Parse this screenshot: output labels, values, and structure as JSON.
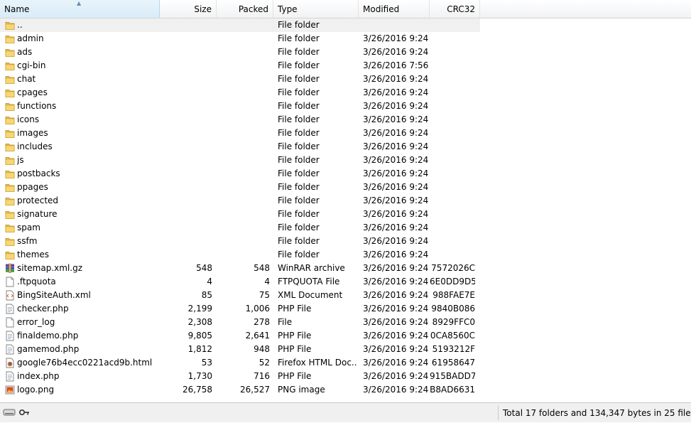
{
  "columns": {
    "name": "Name",
    "size": "Size",
    "packed": "Packed",
    "type": "Type",
    "modified": "Modified",
    "crc": "CRC32"
  },
  "files": [
    {
      "name": "..",
      "size": "",
      "packed": "",
      "type": "File folder",
      "modified": "",
      "crc": "",
      "icon": "folder-icon"
    },
    {
      "name": "admin",
      "size": "",
      "packed": "",
      "type": "File folder",
      "modified": "3/26/2016 9:24",
      "crc": "",
      "icon": "folder-icon"
    },
    {
      "name": "ads",
      "size": "",
      "packed": "",
      "type": "File folder",
      "modified": "3/26/2016 9:24",
      "crc": "",
      "icon": "folder-icon"
    },
    {
      "name": "cgi-bin",
      "size": "",
      "packed": "",
      "type": "File folder",
      "modified": "3/26/2016 7:56",
      "crc": "",
      "icon": "folder-icon"
    },
    {
      "name": "chat",
      "size": "",
      "packed": "",
      "type": "File folder",
      "modified": "3/26/2016 9:24",
      "crc": "",
      "icon": "folder-icon"
    },
    {
      "name": "cpages",
      "size": "",
      "packed": "",
      "type": "File folder",
      "modified": "3/26/2016 9:24",
      "crc": "",
      "icon": "folder-icon"
    },
    {
      "name": "functions",
      "size": "",
      "packed": "",
      "type": "File folder",
      "modified": "3/26/2016 9:24",
      "crc": "",
      "icon": "folder-icon"
    },
    {
      "name": "icons",
      "size": "",
      "packed": "",
      "type": "File folder",
      "modified": "3/26/2016 9:24",
      "crc": "",
      "icon": "folder-icon"
    },
    {
      "name": "images",
      "size": "",
      "packed": "",
      "type": "File folder",
      "modified": "3/26/2016 9:24",
      "crc": "",
      "icon": "folder-icon"
    },
    {
      "name": "includes",
      "size": "",
      "packed": "",
      "type": "File folder",
      "modified": "3/26/2016 9:24",
      "crc": "",
      "icon": "folder-icon"
    },
    {
      "name": "js",
      "size": "",
      "packed": "",
      "type": "File folder",
      "modified": "3/26/2016 9:24",
      "crc": "",
      "icon": "folder-icon"
    },
    {
      "name": "postbacks",
      "size": "",
      "packed": "",
      "type": "File folder",
      "modified": "3/26/2016 9:24",
      "crc": "",
      "icon": "folder-icon"
    },
    {
      "name": "ppages",
      "size": "",
      "packed": "",
      "type": "File folder",
      "modified": "3/26/2016 9:24",
      "crc": "",
      "icon": "folder-icon"
    },
    {
      "name": "protected",
      "size": "",
      "packed": "",
      "type": "File folder",
      "modified": "3/26/2016 9:24",
      "crc": "",
      "icon": "folder-icon"
    },
    {
      "name": "signature",
      "size": "",
      "packed": "",
      "type": "File folder",
      "modified": "3/26/2016 9:24",
      "crc": "",
      "icon": "folder-icon"
    },
    {
      "name": "spam",
      "size": "",
      "packed": "",
      "type": "File folder",
      "modified": "3/26/2016 9:24",
      "crc": "",
      "icon": "folder-icon"
    },
    {
      "name": "ssfm",
      "size": "",
      "packed": "",
      "type": "File folder",
      "modified": "3/26/2016 9:24",
      "crc": "",
      "icon": "folder-icon"
    },
    {
      "name": "themes",
      "size": "",
      "packed": "",
      "type": "File folder",
      "modified": "3/26/2016 9:24",
      "crc": "",
      "icon": "folder-icon"
    },
    {
      "name": "sitemap.xml.gz",
      "size": "548",
      "packed": "548",
      "type": "WinRAR archive",
      "modified": "3/26/2016 9:24",
      "crc": "7572026C",
      "icon": "archive-icon"
    },
    {
      "name": ".ftpquota",
      "size": "4",
      "packed": "4",
      "type": "FTPQUOTA File",
      "modified": "3/26/2016 9:24",
      "crc": "6E0DD9D5",
      "icon": "blank-file-icon"
    },
    {
      "name": "BingSiteAuth.xml",
      "size": "85",
      "packed": "75",
      "type": "XML Document",
      "modified": "3/26/2016 9:24",
      "crc": "988FAE7E",
      "icon": "xml-file-icon"
    },
    {
      "name": "checker.php",
      "size": "2,199",
      "packed": "1,006",
      "type": "PHP File",
      "modified": "3/26/2016 9:24",
      "crc": "9840B086",
      "icon": "text-file-icon"
    },
    {
      "name": "error_log",
      "size": "2,308",
      "packed": "278",
      "type": "File",
      "modified": "3/26/2016 9:24",
      "crc": "8929FFC0",
      "icon": "blank-file-icon"
    },
    {
      "name": "finaldemo.php",
      "size": "9,805",
      "packed": "2,641",
      "type": "PHP File",
      "modified": "3/26/2016 9:24",
      "crc": "0CA8560C",
      "icon": "text-file-icon"
    },
    {
      "name": "gamemod.php",
      "size": "1,812",
      "packed": "948",
      "type": "PHP File",
      "modified": "3/26/2016 9:24",
      "crc": "5193212F",
      "icon": "text-file-icon"
    },
    {
      "name": "google76b4ecc0221acd9b.html",
      "size": "53",
      "packed": "52",
      "type": "Firefox HTML Doc...",
      "modified": "3/26/2016 9:24",
      "crc": "61958647",
      "icon": "html-file-icon"
    },
    {
      "name": "index.php",
      "size": "1,730",
      "packed": "716",
      "type": "PHP File",
      "modified": "3/26/2016 9:24",
      "crc": "915BADD7",
      "icon": "text-file-icon"
    },
    {
      "name": "logo.png",
      "size": "26,758",
      "packed": "26,527",
      "type": "PNG image",
      "modified": "3/26/2016 9:24",
      "crc": "B8AD6631",
      "icon": "image-file-icon"
    }
  ],
  "status": {
    "text": "Total 17 folders and 134,347 bytes in 25 files",
    "icon": "drive-key-icon"
  }
}
